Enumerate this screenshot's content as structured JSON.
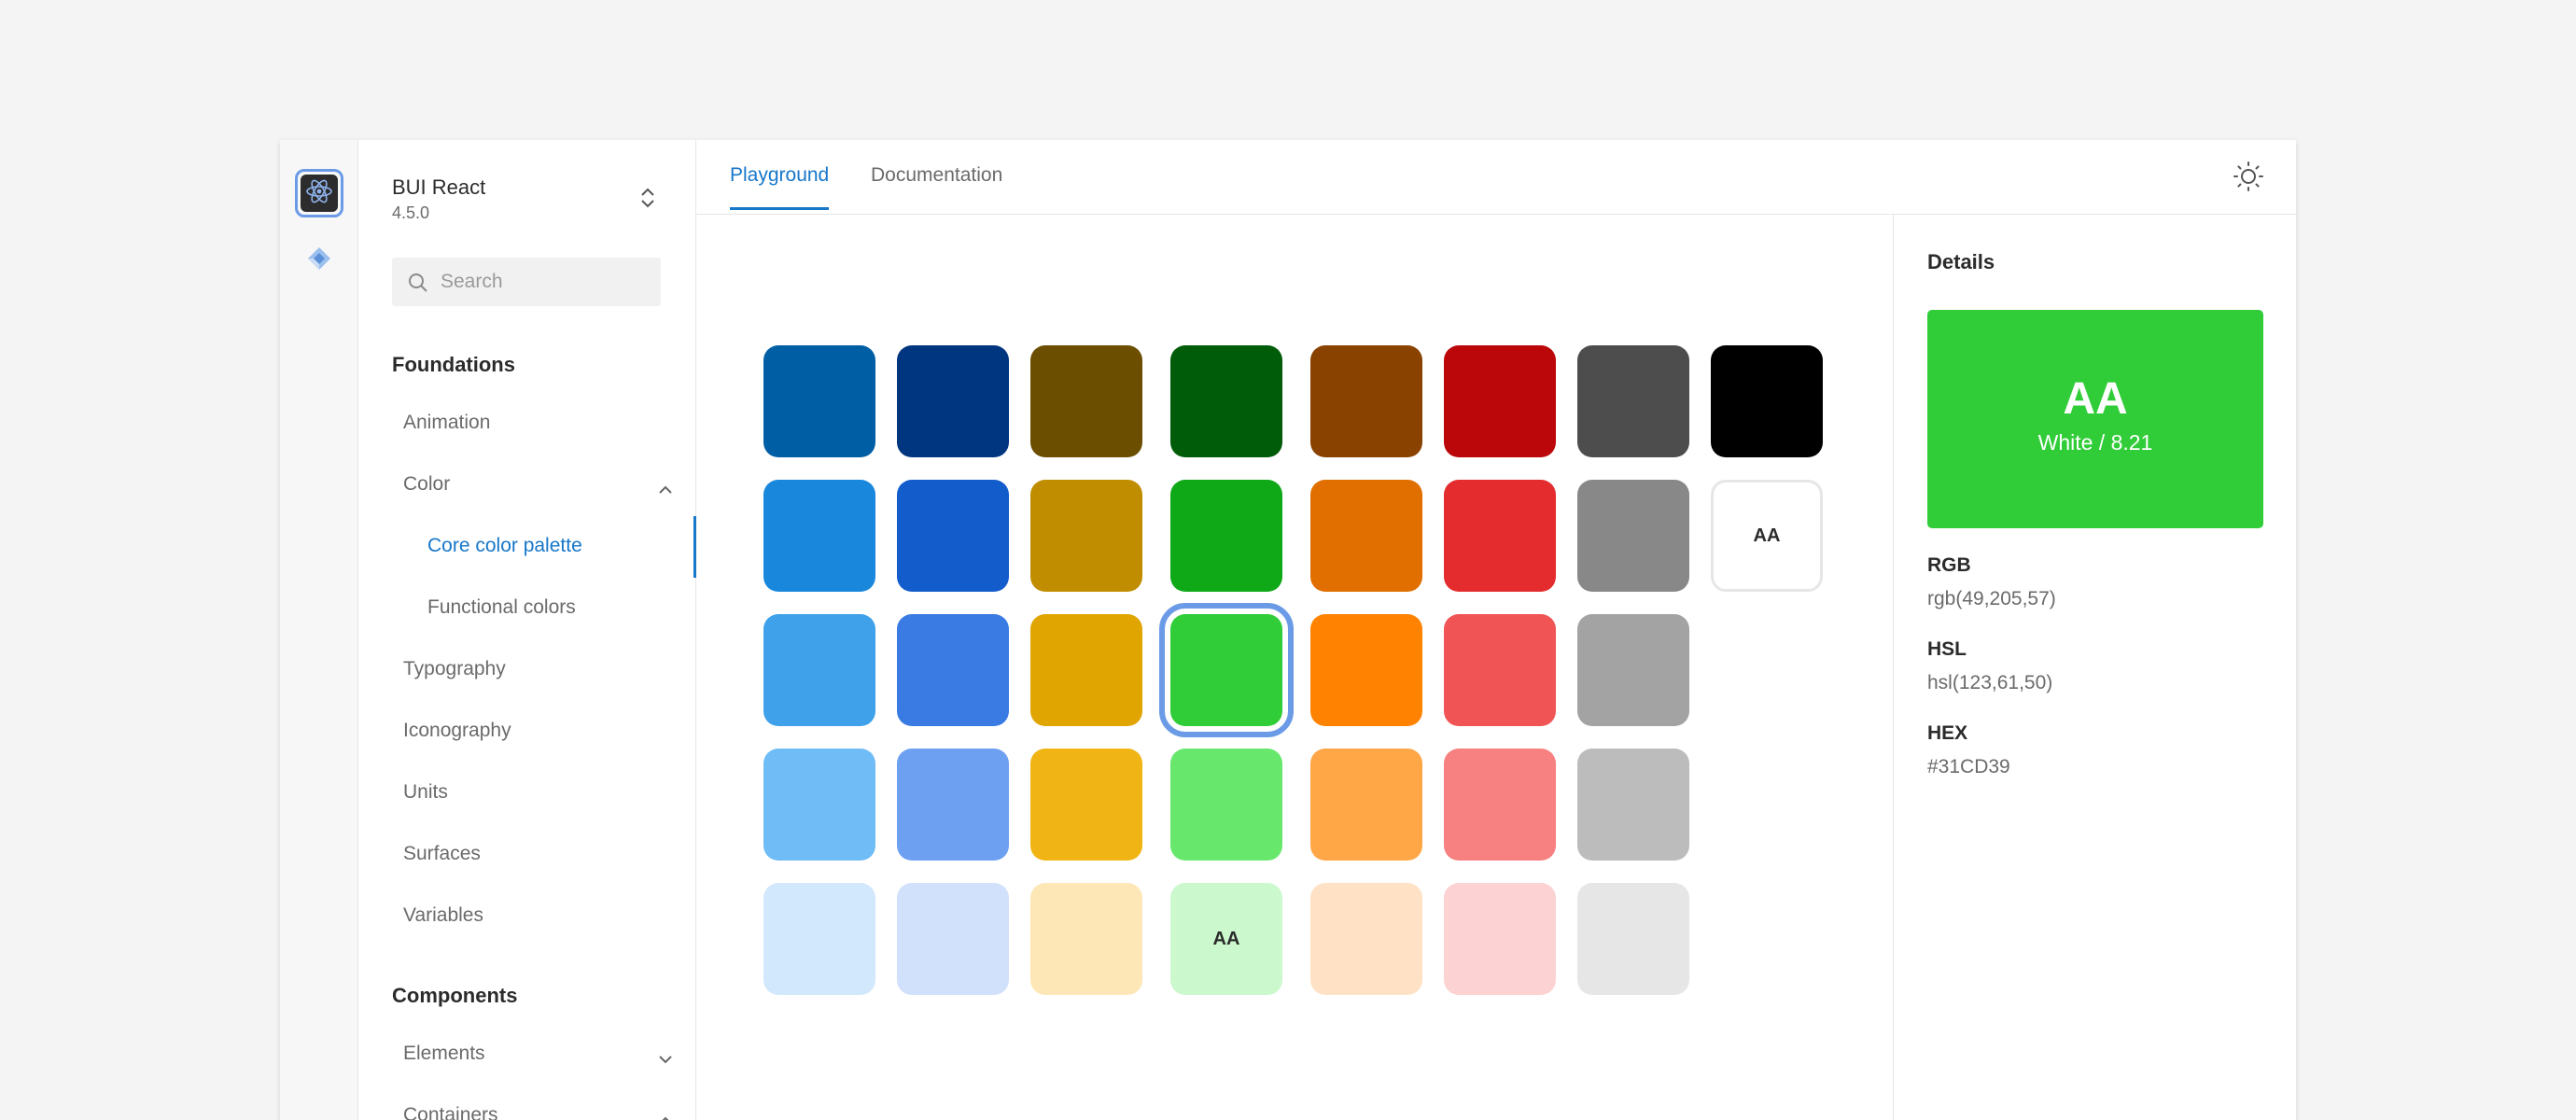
{
  "project": {
    "name": "BUI React",
    "version": "4.5.0"
  },
  "search": {
    "placeholder": "Search"
  },
  "sidebar": {
    "foundations_heading": "Foundations",
    "items": [
      {
        "label": "Animation"
      },
      {
        "label": "Color"
      },
      {
        "label": "Core color palette"
      },
      {
        "label": "Functional colors"
      },
      {
        "label": "Typography"
      },
      {
        "label": "Iconography"
      },
      {
        "label": "Units"
      },
      {
        "label": "Surfaces"
      },
      {
        "label": "Variables"
      }
    ],
    "components_heading": "Components",
    "component_items": [
      {
        "label": "Elements"
      },
      {
        "label": "Containers"
      }
    ]
  },
  "tabs": [
    {
      "label": "Playground"
    },
    {
      "label": "Documentation"
    }
  ],
  "palette": {
    "contrast_sample": "AA",
    "swatches": [
      [
        "#005ea5",
        "#00357f",
        "#6b4e00",
        "#005c08",
        "#8a4200",
        "#bc070a",
        "#4d4d4d",
        "#000000"
      ],
      [
        "#1887dc",
        "#135ccc",
        "#c08d00",
        "#0fa817",
        "#e06f00",
        "#e42c2f",
        "#888888",
        "#ffffff"
      ],
      [
        "#3ea1ea",
        "#3a7be3",
        "#e0a500",
        "#31cd39",
        "#ff8300",
        "#f05455",
        "#a3a3a3"
      ],
      [
        "#70bcf6",
        "#6ea0f1",
        "#f0b514",
        "#67e86d",
        "#ffa647",
        "#f78080",
        "#bcbcbc"
      ],
      [
        "#d2e8fc",
        "#d1e0fb",
        "#fde7b6",
        "#cbf8cd",
        "#ffe2c5",
        "#fdd2d2",
        "#e6e6e6"
      ]
    ],
    "selected": "#31cd39"
  },
  "details": {
    "title": "Details",
    "preview_text": "AA",
    "preview_ratio": "White / 8.21",
    "preview_color": "#31cd39",
    "rgb_label": "RGB",
    "rgb_value": "rgb(49,205,57)",
    "hsl_label": "HSL",
    "hsl_value": "hsl(123,61,50)",
    "hex_label": "HEX",
    "hex_value": "#31CD39"
  }
}
